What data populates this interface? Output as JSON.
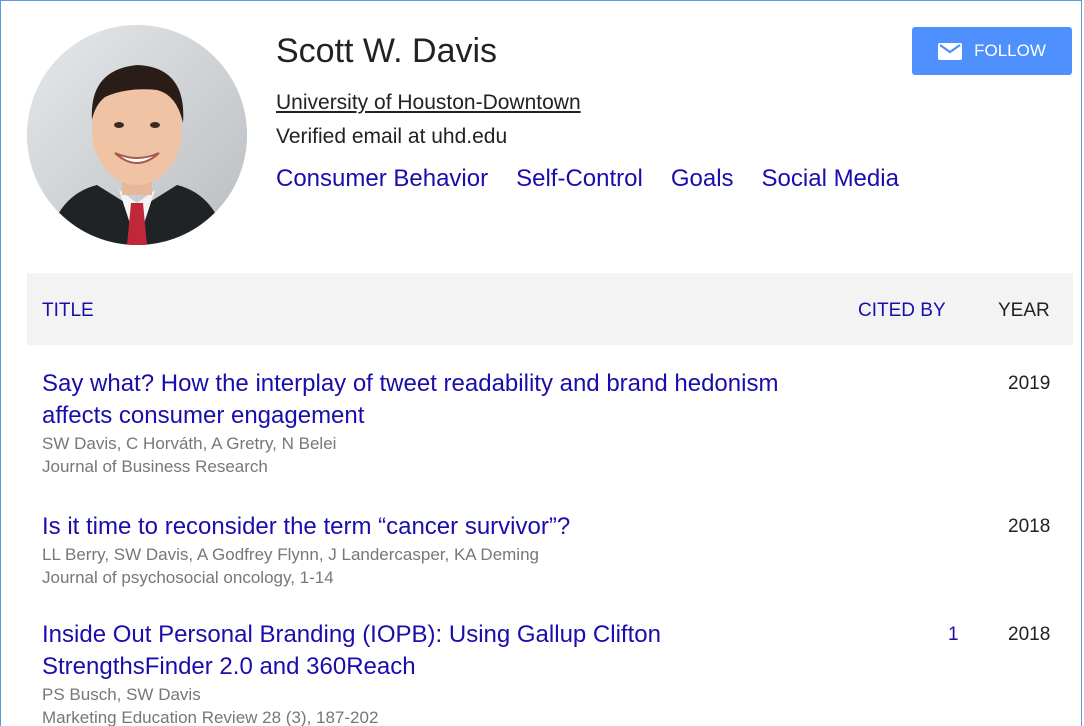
{
  "profile": {
    "name": "Scott W. Davis",
    "affiliation": "University of Houston-Downtown",
    "email": "Verified email at uhd.edu",
    "interests": [
      "Consumer Behavior",
      "Self-Control",
      "Goals",
      "Social Media"
    ],
    "follow_label": "FOLLOW"
  },
  "table": {
    "headers": {
      "title": "TITLE",
      "cited_by": "CITED BY",
      "year": "YEAR"
    },
    "rows": [
      {
        "title": "Say what? How the interplay of tweet readability and brand hedonism affects consumer engagement",
        "authors": "SW Davis, C Horváth, A Gretry, N Belei",
        "venue": "Journal of Business Research",
        "cited_by": "",
        "year": "2019"
      },
      {
        "title": "Is it time to reconsider the term “cancer survivor”?",
        "authors": "LL Berry, SW Davis, A Godfrey Flynn, J Landercasper, KA Deming",
        "venue": "Journal of psychosocial oncology, 1-14",
        "cited_by": "",
        "year": "2018"
      },
      {
        "title": "Inside Out Personal Branding (IOPB): Using Gallup Clifton StrengthsFinder 2.0 and 360Reach",
        "authors": "PS Busch, SW Davis",
        "venue": "Marketing Education Review 28 (3), 187-202",
        "cited_by": "1",
        "year": "2018"
      }
    ]
  },
  "colors": {
    "link": "#1a0dab",
    "button": "#4d90fe",
    "header_bg": "#f3f3f3"
  },
  "icons": {
    "follow": "mail-icon",
    "avatar": "profile-photo"
  }
}
